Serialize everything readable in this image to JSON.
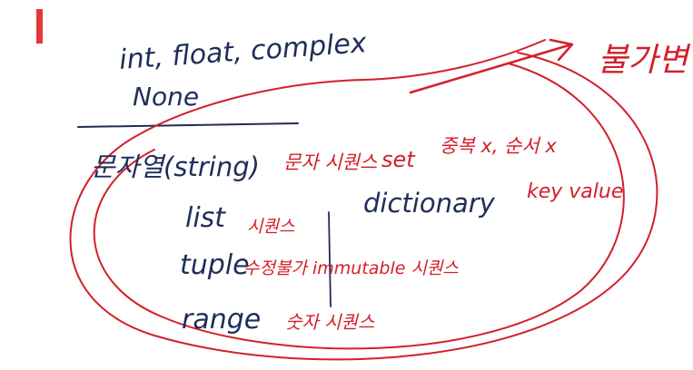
{
  "board": {
    "numeric_types": "int, float, complex",
    "none_type": "None",
    "immutable_label": "불가변",
    "string_type": "문자열(string)",
    "string_note": "문자 시퀀스",
    "set_type": "set",
    "set_note": "중복 x, 순서 x",
    "list_type": "list",
    "list_note": "시퀀스",
    "tuple_type": "tuple",
    "tuple_note": "수정불가 immutable 시퀀스",
    "range_type": "range",
    "range_note": "숫자 시퀀스",
    "dict_type": "dictionary",
    "dict_note": "key value"
  },
  "colors": {
    "navy_ink": "#1f2d5a",
    "red_ink": "#d3202a",
    "cursor": "#e53935"
  }
}
